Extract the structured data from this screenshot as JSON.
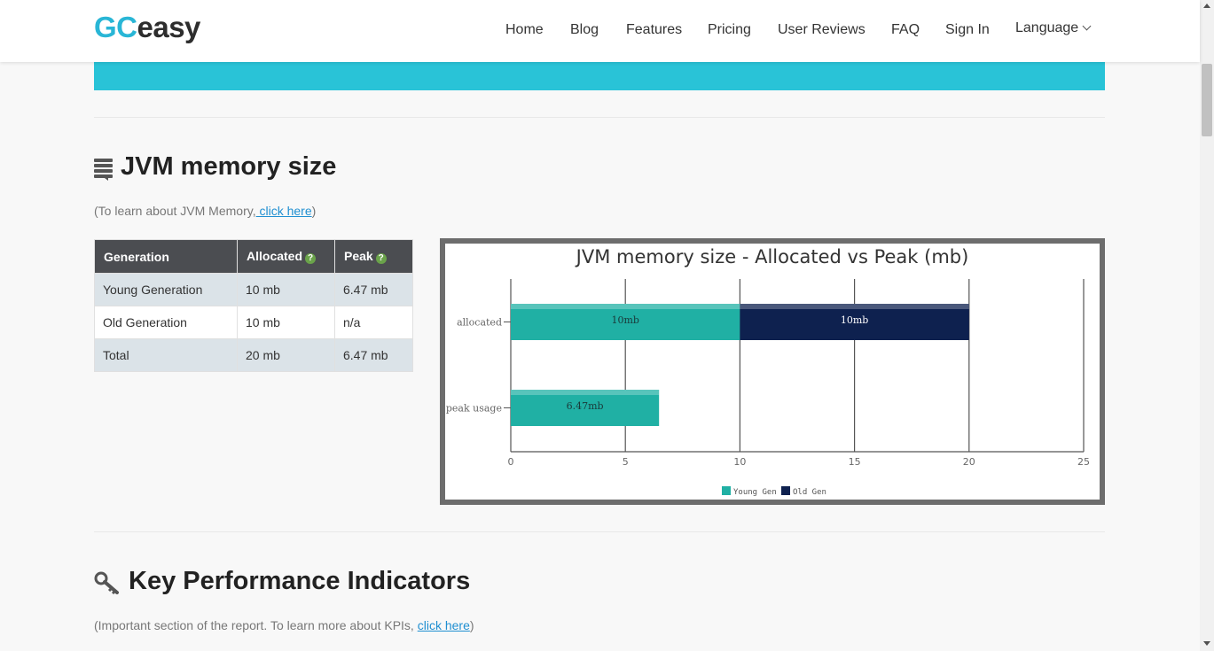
{
  "header": {
    "logo_gc": "GC",
    "logo_easy": "easy",
    "nav": [
      "Home",
      "Blog",
      "Features",
      "Pricing",
      "User Reviews",
      "FAQ",
      "Sign In"
    ],
    "language": "Language"
  },
  "jvm_section": {
    "title": "JVM memory size",
    "note_prefix": "(To learn about JVM Memory,",
    "note_link": " click here",
    "note_suffix": ")",
    "table": {
      "headers": [
        "Generation",
        "Allocated",
        "Peak"
      ],
      "rows": [
        [
          "Young Generation",
          "10 mb",
          "6.47 mb"
        ],
        [
          "Old Generation",
          "10 mb",
          "n/a"
        ],
        [
          "Total",
          "20 mb",
          "6.47 mb"
        ]
      ]
    }
  },
  "kpi_section": {
    "title": "Key Performance Indicators",
    "note_prefix": "(Important section of the report. To learn more about KPIs, ",
    "note_link": "click here",
    "note_suffix": ")"
  },
  "colors": {
    "accent": "#29c3d7",
    "young_gen": "#20b0a4",
    "old_gen": "#0e214f",
    "help_icon": "#6aa34a"
  },
  "chart_data": {
    "type": "bar",
    "orientation": "horizontal",
    "stacked": true,
    "title": "JVM memory size - Allocated vs Peak (mb)",
    "categories": [
      "allocated",
      "peak usage"
    ],
    "series": [
      {
        "name": "Young Gen",
        "values": [
          10,
          6.47
        ],
        "labels": [
          "10mb",
          "6.47mb"
        ],
        "color": "#20b0a4"
      },
      {
        "name": "Old Gen",
        "values": [
          10,
          null
        ],
        "labels": [
          "10mb",
          ""
        ],
        "color": "#0e214f"
      }
    ],
    "xlim": [
      0,
      25
    ],
    "xticks": [
      0,
      5,
      10,
      15,
      20,
      25
    ],
    "grid": true,
    "legend": "bottom"
  }
}
